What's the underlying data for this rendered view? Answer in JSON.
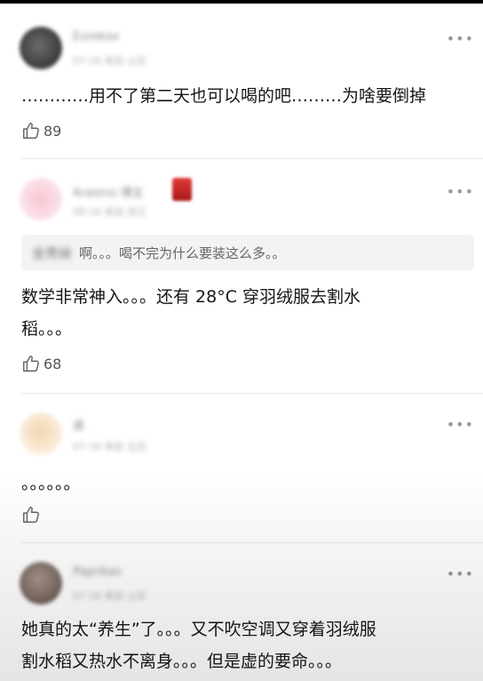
{
  "comments": [
    {
      "author": "Eurekax",
      "meta": "07-16 来自 山东",
      "text": "…………用不了第二天也可以喝的吧………为啥要倒掉",
      "likes": "89"
    },
    {
      "author": "Arasmo 博主",
      "meta": "08-16 来自 浙江",
      "quote_author": "金秀妹",
      "quote_text": "啊。。。喝不完为什么要装这么多。。",
      "text_line1": "数学非常神入。。。还有 28°C 穿羽绒服去割水",
      "text_line2": "稻。。。",
      "likes": "68"
    },
    {
      "author": "桌",
      "meta": "07-16 来自 北京",
      "text": "。。。。。。",
      "likes": ""
    },
    {
      "author": "Paprikas",
      "meta": "07-16 来自 山东",
      "text_line1": "她真的太“养生”了。。。又不吹空调又穿着羽绒服",
      "text_line2": "割水稻又热水不离身。。。但是虚的要命。。。"
    }
  ],
  "more_label": "•••",
  "colors": {
    "avatar1": "#4a4a4a",
    "avatar2": "#f2b7c4",
    "avatar3": "#f5e2c8",
    "avatar4": "#8a7a72",
    "badge": "#d62828"
  }
}
